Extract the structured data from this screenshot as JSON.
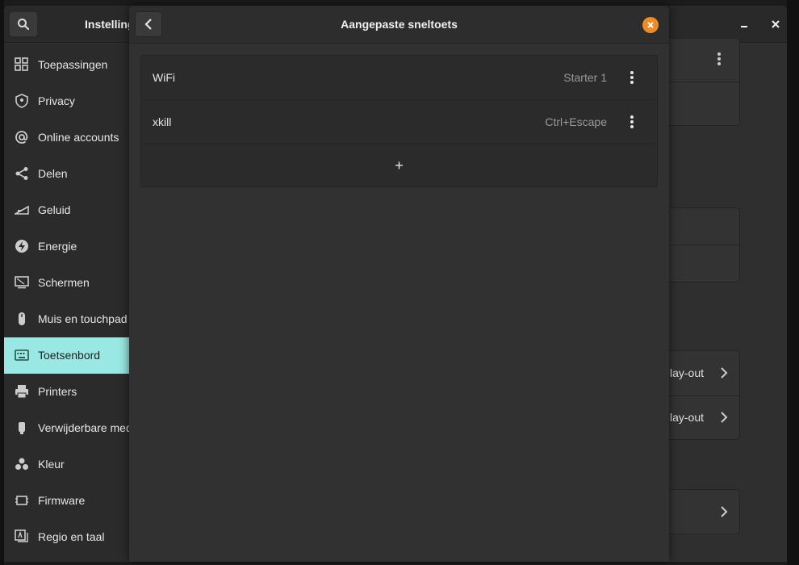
{
  "main_window": {
    "title": "Instellingen",
    "sidebar": [
      {
        "label": "Toepassingen",
        "icon": "grid-icon"
      },
      {
        "label": "Privacy",
        "icon": "privacy-icon"
      },
      {
        "label": "Online accounts",
        "icon": "at-icon"
      },
      {
        "label": "Delen",
        "icon": "share-icon"
      },
      {
        "label": "Geluid",
        "icon": "sound-icon"
      },
      {
        "label": "Energie",
        "icon": "power-icon"
      },
      {
        "label": "Schermen",
        "icon": "display-icon"
      },
      {
        "label": "Muis en touchpad",
        "icon": "mouse-icon"
      },
      {
        "label": "Toetsenbord",
        "icon": "keyboard-icon",
        "active": true
      },
      {
        "label": "Printers",
        "icon": "printer-icon"
      },
      {
        "label": "Verwijderbare media",
        "icon": "usb-icon"
      },
      {
        "label": "Kleur",
        "icon": "color-icon"
      },
      {
        "label": "Firmware",
        "icon": "chip-icon"
      },
      {
        "label": "Regio en taal",
        "icon": "language-icon"
      }
    ],
    "background_text": {
      "layout_1": "lay-out",
      "layout_2": "lay-out"
    }
  },
  "dialog": {
    "title": "Aangepaste sneltoets",
    "shortcuts": [
      {
        "name": "WiFi",
        "accel": "Starter 1"
      },
      {
        "name": "xkill",
        "accel": "Ctrl+Escape"
      }
    ],
    "add_label": "+"
  },
  "colors": {
    "accent_active": "#9ae8e3",
    "close_button": "#f08a24"
  }
}
